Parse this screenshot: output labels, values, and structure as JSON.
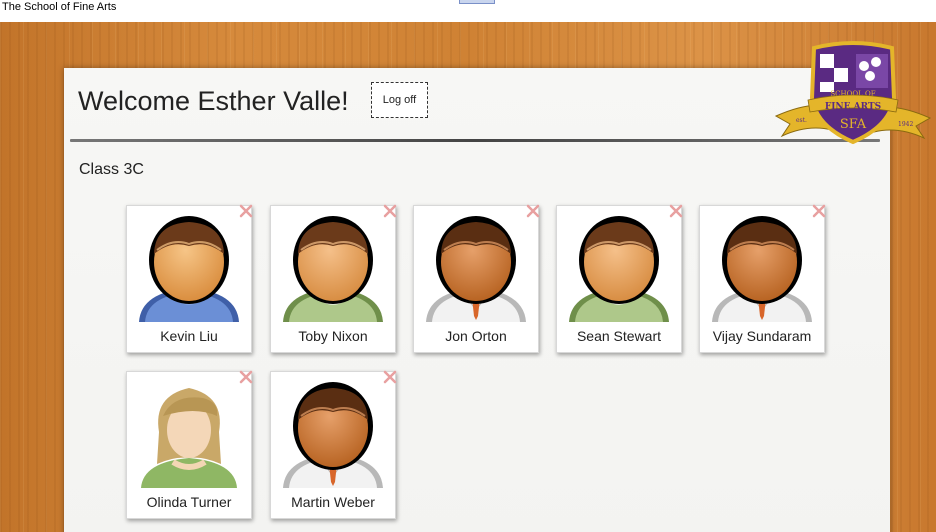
{
  "window": {
    "title": "The School of Fine Arts"
  },
  "header": {
    "welcome": "Welcome Esther Valle!",
    "logoff_label": "Log off"
  },
  "class": {
    "name": "Class 3C"
  },
  "students": [
    {
      "name": "Kevin Liu",
      "avatar": "male-blue-sweater-icon"
    },
    {
      "name": "Toby Nixon",
      "avatar": "male-green-jacket-icon"
    },
    {
      "name": "Jon Orton",
      "avatar": "male-white-shirt-icon"
    },
    {
      "name": "Sean Stewart",
      "avatar": "male-green-jacket-icon"
    },
    {
      "name": "Vijay Sundaram",
      "avatar": "male-white-shirt-icon"
    },
    {
      "name": "Olinda Turner",
      "avatar": "female-green-top-icon"
    },
    {
      "name": "Martin Weber",
      "avatar": "male-white-shirt-icon"
    }
  ],
  "crest": {
    "line1": "SCHOOL OF",
    "line2": "FINE ARTS",
    "initials": "SFA",
    "left_ribbon": "est.",
    "right_ribbon": "1942",
    "colors": {
      "purple": "#5a2a82",
      "gold": "#e4b52a"
    }
  },
  "colors": {
    "wood": "#d08636",
    "paper": "#f5f5f3",
    "text": "#222222"
  }
}
